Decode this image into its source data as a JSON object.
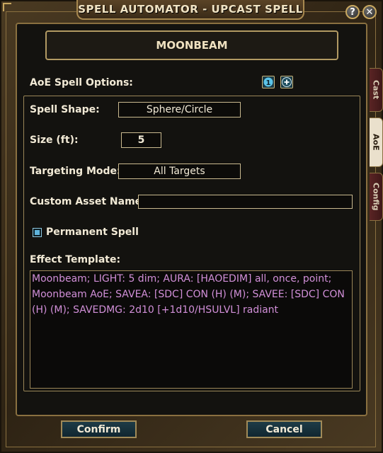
{
  "window": {
    "title": "SPELL AUTOMATOR - UPCAST SPELL",
    "help_label": "?",
    "close_label": "✕"
  },
  "spell": {
    "name": "MOONBEAM"
  },
  "aoe": {
    "section_label": "AoE Spell Options:",
    "badge_label": "1",
    "add_label": "+"
  },
  "fields": {
    "shape_label": "Spell Shape:",
    "shape_value": "Sphere/Circle",
    "size_label": "Size (ft):",
    "size_value": "5",
    "targeting_label": "Targeting Mode:",
    "targeting_value": "All Targets",
    "asset_label": "Custom Asset Name:",
    "asset_value": ""
  },
  "permanent": {
    "label": "Permanent Spell",
    "checked": true
  },
  "template": {
    "label": "Effect Template:",
    "text": "Moonbeam; LIGHT: 5 dim; AURA: [HAOEDIM] all, once, point; Moonbeam AoE; SAVEA: [SDC] CON (H) (M); SAVEE: [SDC] CON (H) (M); SAVEDMG: 2d10 [+1d10/HSULVL] radiant"
  },
  "tabs": [
    {
      "label": "Cast",
      "active": false
    },
    {
      "label": "AoE",
      "active": true
    },
    {
      "label": "Config",
      "active": false
    }
  ],
  "buttons": {
    "confirm": "Confirm",
    "cancel": "Cancel"
  },
  "colors": {
    "template_text": "#d18fd8",
    "accent_teal": "#1a3a46",
    "frame_gold": "#a8894f"
  }
}
